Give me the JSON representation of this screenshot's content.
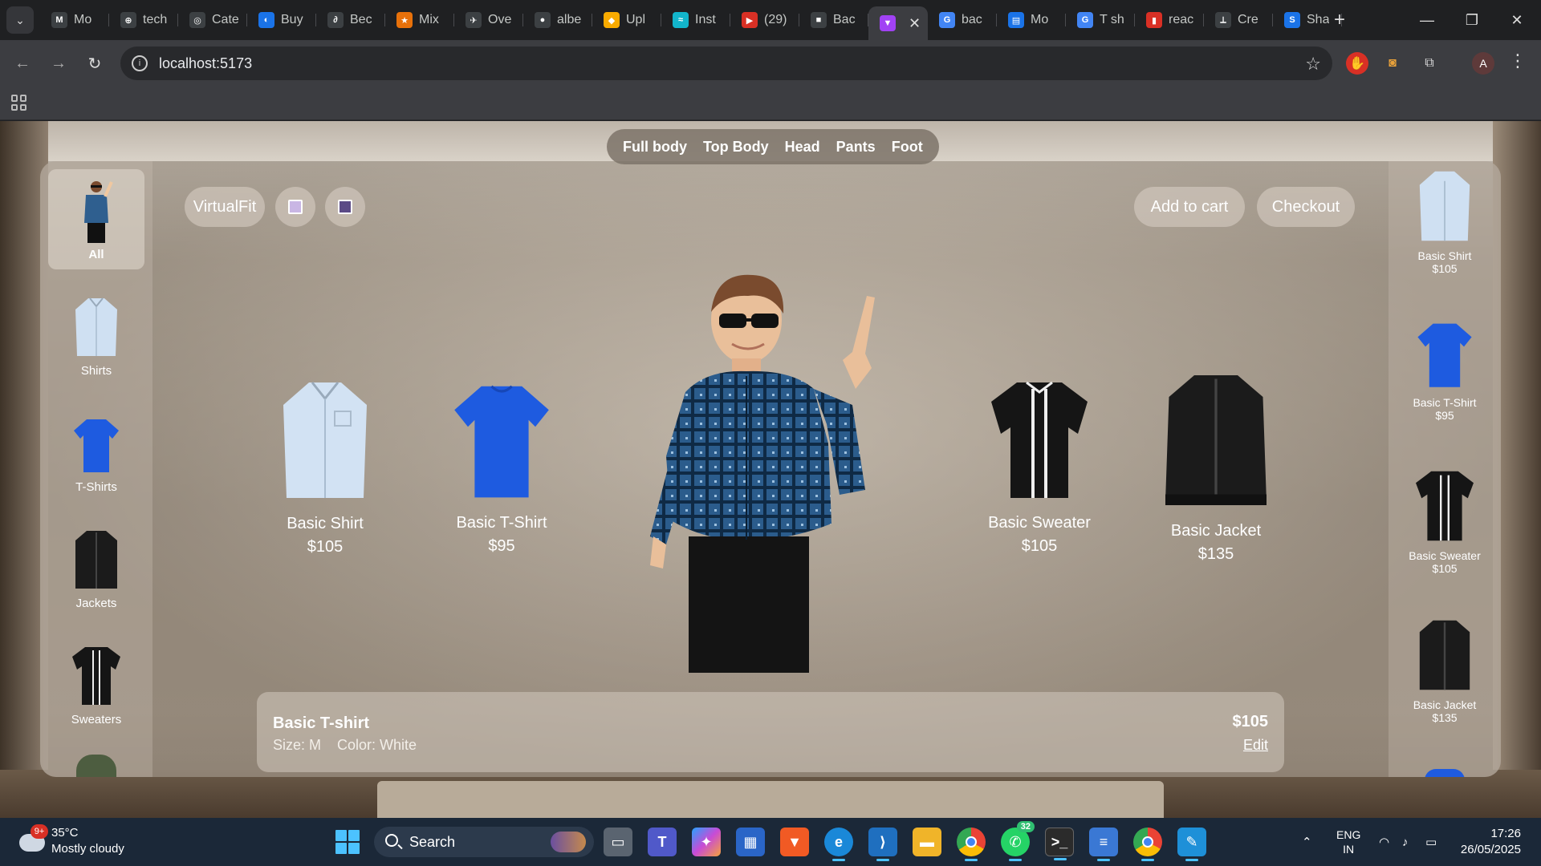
{
  "browser": {
    "tabs": [
      {
        "title": "Mo",
        "fav": "M",
        "color": "#3c4043"
      },
      {
        "title": "tech",
        "fav": "⊕",
        "color": "#3c4043"
      },
      {
        "title": "Cate",
        "fav": "◎",
        "color": "#3c4043"
      },
      {
        "title": "Buy",
        "fav": "◐",
        "color": "#1a73e8"
      },
      {
        "title": "Bec",
        "fav": "∂",
        "color": "#3c4043"
      },
      {
        "title": "Mix",
        "fav": "★",
        "color": "#e8710a"
      },
      {
        "title": "Ove",
        "fav": "✈",
        "color": "#3c4043"
      },
      {
        "title": "albe",
        "fav": "●",
        "color": "#3c4043"
      },
      {
        "title": "Upl",
        "fav": "◆",
        "color": "#f9ab00"
      },
      {
        "title": "Inst",
        "fav": "≈",
        "color": "#12b5cb"
      },
      {
        "title": "(29)",
        "fav": "▶",
        "color": "#d93025"
      },
      {
        "title": "Bac",
        "fav": "■",
        "color": "#3c4043"
      },
      {
        "title": "",
        "fav": "▼",
        "color": "#a142f4",
        "active": true
      },
      {
        "title": "bac",
        "fav": "G",
        "color": "#4285f4"
      },
      {
        "title": "Mo",
        "fav": "▤",
        "color": "#1a73e8"
      },
      {
        "title": "T sh",
        "fav": "G",
        "color": "#4285f4"
      },
      {
        "title": "reac",
        "fav": "▮",
        "color": "#d93025"
      },
      {
        "title": "Cre",
        "fav": "⟂",
        "color": "#3c4043"
      },
      {
        "title": "Sha",
        "fav": "S",
        "color": "#1a73e8"
      }
    ],
    "url": "localhost:5173",
    "profile_initial": "A"
  },
  "app": {
    "top_nav": [
      "Full body",
      "Top Body",
      "Head",
      "Pants",
      "Foot"
    ],
    "categories": [
      {
        "label": "All",
        "active": true,
        "icon": "model-thumbnail"
      },
      {
        "label": "Shirts",
        "icon": "shirt-icon"
      },
      {
        "label": "T-Shirts",
        "icon": "tshirt-icon"
      },
      {
        "label": "Jackets",
        "icon": "jacket-icon"
      },
      {
        "label": "Sweaters",
        "icon": "sweater-icon"
      }
    ],
    "virtualfit_label": "VirtualFit",
    "add_to_cart_label": "Add to cart",
    "checkout_label": "Checkout",
    "products": [
      {
        "name": "Basic Shirt",
        "price": "$105"
      },
      {
        "name": "Basic T-Shirt",
        "price": "$95"
      },
      {
        "name": "Basic Sweater",
        "price": "$105"
      },
      {
        "name": "Basic Jacket",
        "price": "$135"
      }
    ],
    "rail": [
      {
        "name": "Basic Shirt",
        "price": "$105"
      },
      {
        "name": "Basic T-Shirt",
        "price": "$95"
      },
      {
        "name": "Basic Sweater",
        "price": "$105"
      },
      {
        "name": "Basic Jacket",
        "price": "$135"
      }
    ],
    "cart": {
      "item_name": "Basic T-shirt",
      "size": "Size: M",
      "color": "Color: White",
      "price": "$105",
      "edit_label": "Edit"
    }
  },
  "taskbar": {
    "weather_temp": "35°C",
    "weather_desc": "Mostly cloudy",
    "weather_badge": "9+",
    "search_label": "Search",
    "whatsapp_badge": "32",
    "lang_1": "ENG",
    "lang_2": "IN",
    "time": "17:26",
    "date": "26/05/2025"
  }
}
